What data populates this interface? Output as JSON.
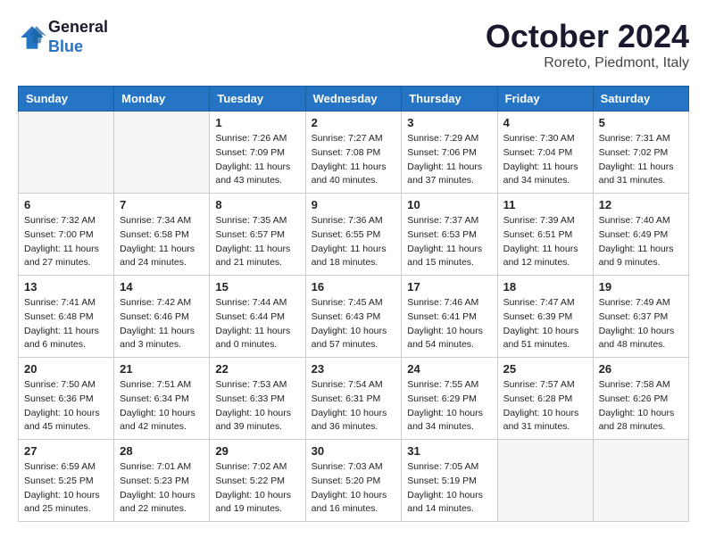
{
  "header": {
    "logo_general": "General",
    "logo_blue": "Blue",
    "month_title": "October 2024",
    "subtitle": "Roreto, Piedmont, Italy"
  },
  "weekdays": [
    "Sunday",
    "Monday",
    "Tuesday",
    "Wednesday",
    "Thursday",
    "Friday",
    "Saturday"
  ],
  "weeks": [
    [
      {
        "day": "",
        "info": ""
      },
      {
        "day": "",
        "info": ""
      },
      {
        "day": "1",
        "info": "Sunrise: 7:26 AM\nSunset: 7:09 PM\nDaylight: 11 hours and 43 minutes."
      },
      {
        "day": "2",
        "info": "Sunrise: 7:27 AM\nSunset: 7:08 PM\nDaylight: 11 hours and 40 minutes."
      },
      {
        "day": "3",
        "info": "Sunrise: 7:29 AM\nSunset: 7:06 PM\nDaylight: 11 hours and 37 minutes."
      },
      {
        "day": "4",
        "info": "Sunrise: 7:30 AM\nSunset: 7:04 PM\nDaylight: 11 hours and 34 minutes."
      },
      {
        "day": "5",
        "info": "Sunrise: 7:31 AM\nSunset: 7:02 PM\nDaylight: 11 hours and 31 minutes."
      }
    ],
    [
      {
        "day": "6",
        "info": "Sunrise: 7:32 AM\nSunset: 7:00 PM\nDaylight: 11 hours and 27 minutes."
      },
      {
        "day": "7",
        "info": "Sunrise: 7:34 AM\nSunset: 6:58 PM\nDaylight: 11 hours and 24 minutes."
      },
      {
        "day": "8",
        "info": "Sunrise: 7:35 AM\nSunset: 6:57 PM\nDaylight: 11 hours and 21 minutes."
      },
      {
        "day": "9",
        "info": "Sunrise: 7:36 AM\nSunset: 6:55 PM\nDaylight: 11 hours and 18 minutes."
      },
      {
        "day": "10",
        "info": "Sunrise: 7:37 AM\nSunset: 6:53 PM\nDaylight: 11 hours and 15 minutes."
      },
      {
        "day": "11",
        "info": "Sunrise: 7:39 AM\nSunset: 6:51 PM\nDaylight: 11 hours and 12 minutes."
      },
      {
        "day": "12",
        "info": "Sunrise: 7:40 AM\nSunset: 6:49 PM\nDaylight: 11 hours and 9 minutes."
      }
    ],
    [
      {
        "day": "13",
        "info": "Sunrise: 7:41 AM\nSunset: 6:48 PM\nDaylight: 11 hours and 6 minutes."
      },
      {
        "day": "14",
        "info": "Sunrise: 7:42 AM\nSunset: 6:46 PM\nDaylight: 11 hours and 3 minutes."
      },
      {
        "day": "15",
        "info": "Sunrise: 7:44 AM\nSunset: 6:44 PM\nDaylight: 11 hours and 0 minutes."
      },
      {
        "day": "16",
        "info": "Sunrise: 7:45 AM\nSunset: 6:43 PM\nDaylight: 10 hours and 57 minutes."
      },
      {
        "day": "17",
        "info": "Sunrise: 7:46 AM\nSunset: 6:41 PM\nDaylight: 10 hours and 54 minutes."
      },
      {
        "day": "18",
        "info": "Sunrise: 7:47 AM\nSunset: 6:39 PM\nDaylight: 10 hours and 51 minutes."
      },
      {
        "day": "19",
        "info": "Sunrise: 7:49 AM\nSunset: 6:37 PM\nDaylight: 10 hours and 48 minutes."
      }
    ],
    [
      {
        "day": "20",
        "info": "Sunrise: 7:50 AM\nSunset: 6:36 PM\nDaylight: 10 hours and 45 minutes."
      },
      {
        "day": "21",
        "info": "Sunrise: 7:51 AM\nSunset: 6:34 PM\nDaylight: 10 hours and 42 minutes."
      },
      {
        "day": "22",
        "info": "Sunrise: 7:53 AM\nSunset: 6:33 PM\nDaylight: 10 hours and 39 minutes."
      },
      {
        "day": "23",
        "info": "Sunrise: 7:54 AM\nSunset: 6:31 PM\nDaylight: 10 hours and 36 minutes."
      },
      {
        "day": "24",
        "info": "Sunrise: 7:55 AM\nSunset: 6:29 PM\nDaylight: 10 hours and 34 minutes."
      },
      {
        "day": "25",
        "info": "Sunrise: 7:57 AM\nSunset: 6:28 PM\nDaylight: 10 hours and 31 minutes."
      },
      {
        "day": "26",
        "info": "Sunrise: 7:58 AM\nSunset: 6:26 PM\nDaylight: 10 hours and 28 minutes."
      }
    ],
    [
      {
        "day": "27",
        "info": "Sunrise: 6:59 AM\nSunset: 5:25 PM\nDaylight: 10 hours and 25 minutes."
      },
      {
        "day": "28",
        "info": "Sunrise: 7:01 AM\nSunset: 5:23 PM\nDaylight: 10 hours and 22 minutes."
      },
      {
        "day": "29",
        "info": "Sunrise: 7:02 AM\nSunset: 5:22 PM\nDaylight: 10 hours and 19 minutes."
      },
      {
        "day": "30",
        "info": "Sunrise: 7:03 AM\nSunset: 5:20 PM\nDaylight: 10 hours and 16 minutes."
      },
      {
        "day": "31",
        "info": "Sunrise: 7:05 AM\nSunset: 5:19 PM\nDaylight: 10 hours and 14 minutes."
      },
      {
        "day": "",
        "info": ""
      },
      {
        "day": "",
        "info": ""
      }
    ]
  ]
}
